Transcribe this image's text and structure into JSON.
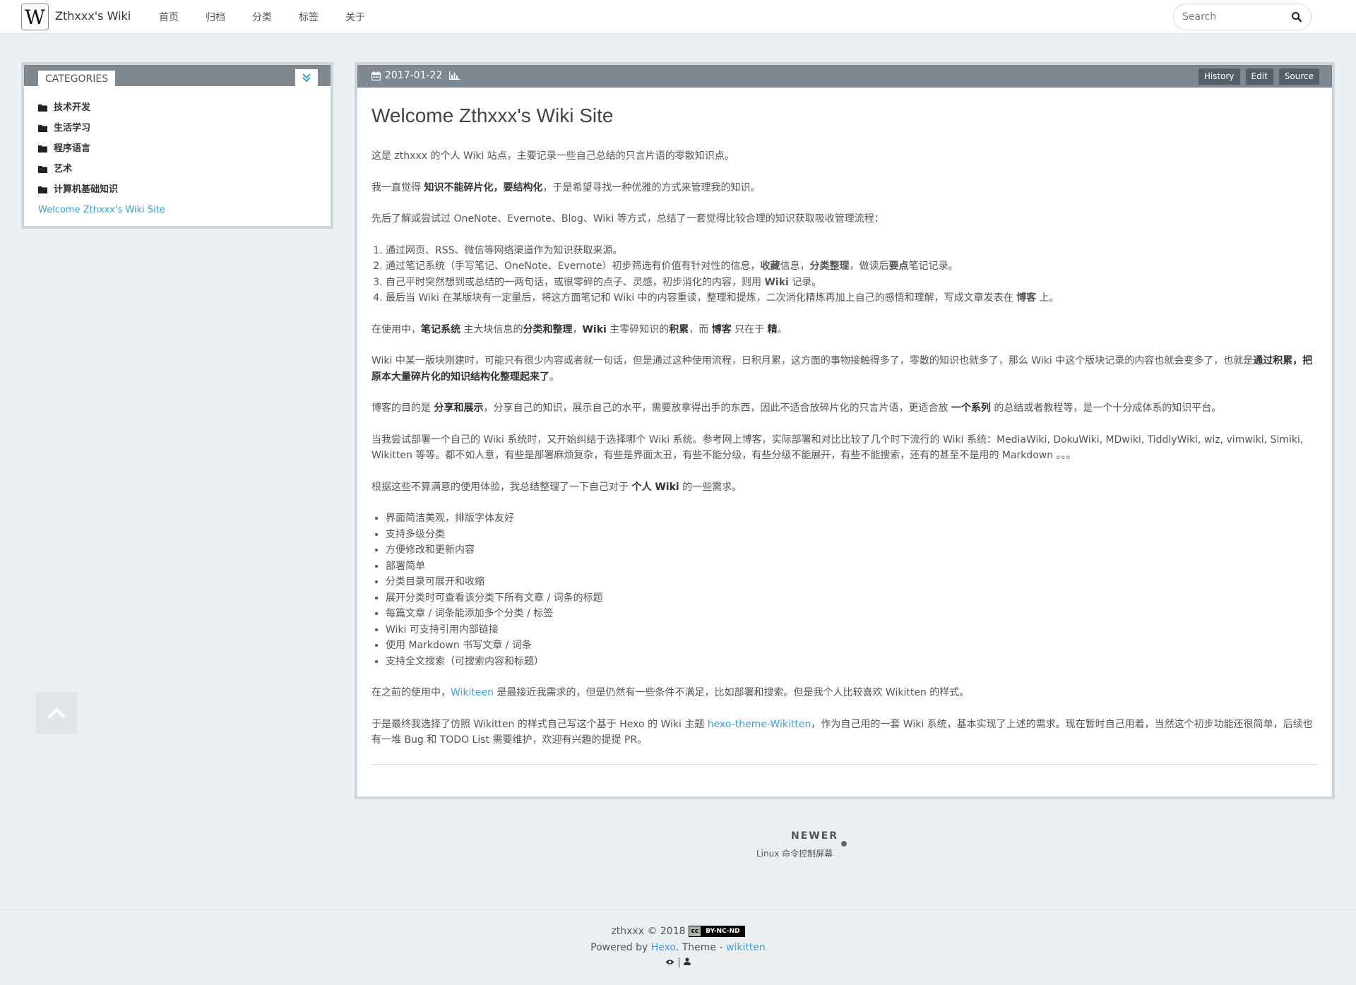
{
  "header": {
    "logo_letter": "W",
    "brand": "Zthxxx's Wiki",
    "nav": [
      "首页",
      "归档",
      "分类",
      "标签",
      "关于"
    ],
    "search_placeholder": "Search"
  },
  "sidebar": {
    "tab": "CATEGORIES",
    "categories": [
      "技术开发",
      "生活学习",
      "程序语言",
      "艺术",
      "计算机基础知识"
    ],
    "post_link": "Welcome Zthxxx's Wiki Site"
  },
  "article": {
    "date": "2017-01-22",
    "buttons": {
      "history": "History",
      "edit": "Edit",
      "source": "Source"
    },
    "title": "Welcome Zthxxx's Wiki Site",
    "p1": "这是 zthxxx 的个人 Wiki 站点，主要记录一些自己总结的只言片语的零散知识点。",
    "p2": {
      "a": "我一直觉得 ",
      "b": "知识不能碎片化，要结构化",
      "c": "，于是希望寻找一种优雅的方式来管理我的知识。"
    },
    "p3": "先后了解或尝试过 OneNote、Evernote、Blog、Wiki 等方式，总结了一套觉得比较合理的知识获取吸收管理流程：",
    "steps": {
      "s1": "通过网页、RSS、微信等网络渠道作为知识获取来源。",
      "s2a": "通过笔记系统（手写笔记、OneNote、Evernote）初步筛选有价值有针对性的信息，",
      "s2b": "收藏",
      "s2c": "信息，",
      "s2d": "分类整理",
      "s2e": "，做读后",
      "s2f": "要点",
      "s2g": "笔记记录。",
      "s3a": "自己平时突然想到或总结的一两句话，或很零碎的点子、灵感，初步消化的内容，则用 ",
      "s3b": "Wiki",
      "s3c": " 记录。",
      "s4a": "最后当 Wiki 在某版块有一定量后，将这方面笔记和 Wiki 中的内容重读，整理和提炼，二次消化精炼再加上自己的感悟和理解，写成文章发表在 ",
      "s4b": "博客",
      "s4c": " 上。"
    },
    "p4": {
      "a": "在使用中，",
      "b": "笔记系统",
      "c": " 主大块信息的",
      "d": "分类和整理",
      "e": "，",
      "f": "Wiki",
      "g": " 主零碎知识的",
      "h": "积累",
      "i": "，而 ",
      "j": "博客",
      "k": " 只在于 ",
      "l": "精",
      "m": "。"
    },
    "p5": {
      "a": "Wiki 中某一版块刚建时，可能只有很少内容或者就一句话，但是通过这种使用流程，日积月累，这方面的事物接触得多了，零散的知识也就多了，那么 Wiki 中这个版块记录的内容也就会变多了，也就是",
      "b": "通过积累，把原本大量碎片化的知识结构化整理起来了",
      "c": "。"
    },
    "p6": {
      "a": "博客的目的是 ",
      "b": "分享和展示",
      "c": "，分享自己的知识，展示自己的水平，需要放拿得出手的东西，因此不适合放碎片化的只言片语，更适合放 ",
      "d": "一个系列",
      "e": " 的总结或者教程等，是一个十分成体系的知识平台。"
    },
    "p7": "当我尝试部署一个自己的 Wiki 系统时，又开始纠结于选择哪个 Wiki 系统。参考网上博客，实际部署和对比比较了几个时下流行的 Wiki 系统：MediaWiki, DokuWiki, MDwiki, TiddlyWiki, wiz, vimwiki, Simiki, Wikitten 等等。都不如人意，有些是部署麻烦复杂，有些是界面太丑，有些不能分级，有些分级不能展开，有些不能搜索，还有的甚至不是用的 Markdown 。。。",
    "p8": {
      "a": "根据这些不算满意的使用体验，我总结整理了一下自己对于 ",
      "b": "个人 Wiki",
      "c": " 的一些需求。"
    },
    "needs": [
      "界面简洁美观，排版字体友好",
      "支持多级分类",
      "方便修改和更新内容",
      "部署简单",
      "分类目录可展开和收缩",
      "展开分类时可查看该分类下所有文章 / 词条的标题",
      "每篇文章 / 词条能添加多个分类 / 标签",
      "Wiki 可支持引用内部链接",
      "使用 Markdown 书写文章 / 词条",
      "支持全文搜索（可搜索内容和标题）"
    ],
    "p9": {
      "a": "在之前的使用中，",
      "link": "Wikiteen",
      "b": " 是最接近我需求的，但是仍然有一些条件不满足，比如部署和搜索。但是我个人比较喜欢 Wikitten 的样式。"
    },
    "p10": {
      "a": "于是最终我选择了仿照 Wikitten 的样式自己写这个基于 Hexo 的 Wiki 主题 ",
      "link": "hexo-theme-Wikitten",
      "b": "，作为自己用的一套 Wiki 系统，基本实现了上述的需求。现在暂时自己用着，当然这个初步功能还很简单，后续也有一堆 Bug 和 TODO List 需要维护，欢迎有兴趣的提提 PR。"
    }
  },
  "pager": {
    "label": "NEWER",
    "link": "Linux 命令控制屏幕"
  },
  "footer": {
    "copyright": "zthxxx © 2018",
    "license_cc": "cc",
    "license_text": "BY-NC-ND",
    "powered_a": "Powered by ",
    "powered_hexo": "Hexo",
    "powered_b": ". Theme - ",
    "powered_theme": "wikitten",
    "sep": "|"
  },
  "colors": {
    "accent": "#3aa3d8",
    "header_bar": "#7d8891",
    "frame": "#cfd6dc"
  }
}
